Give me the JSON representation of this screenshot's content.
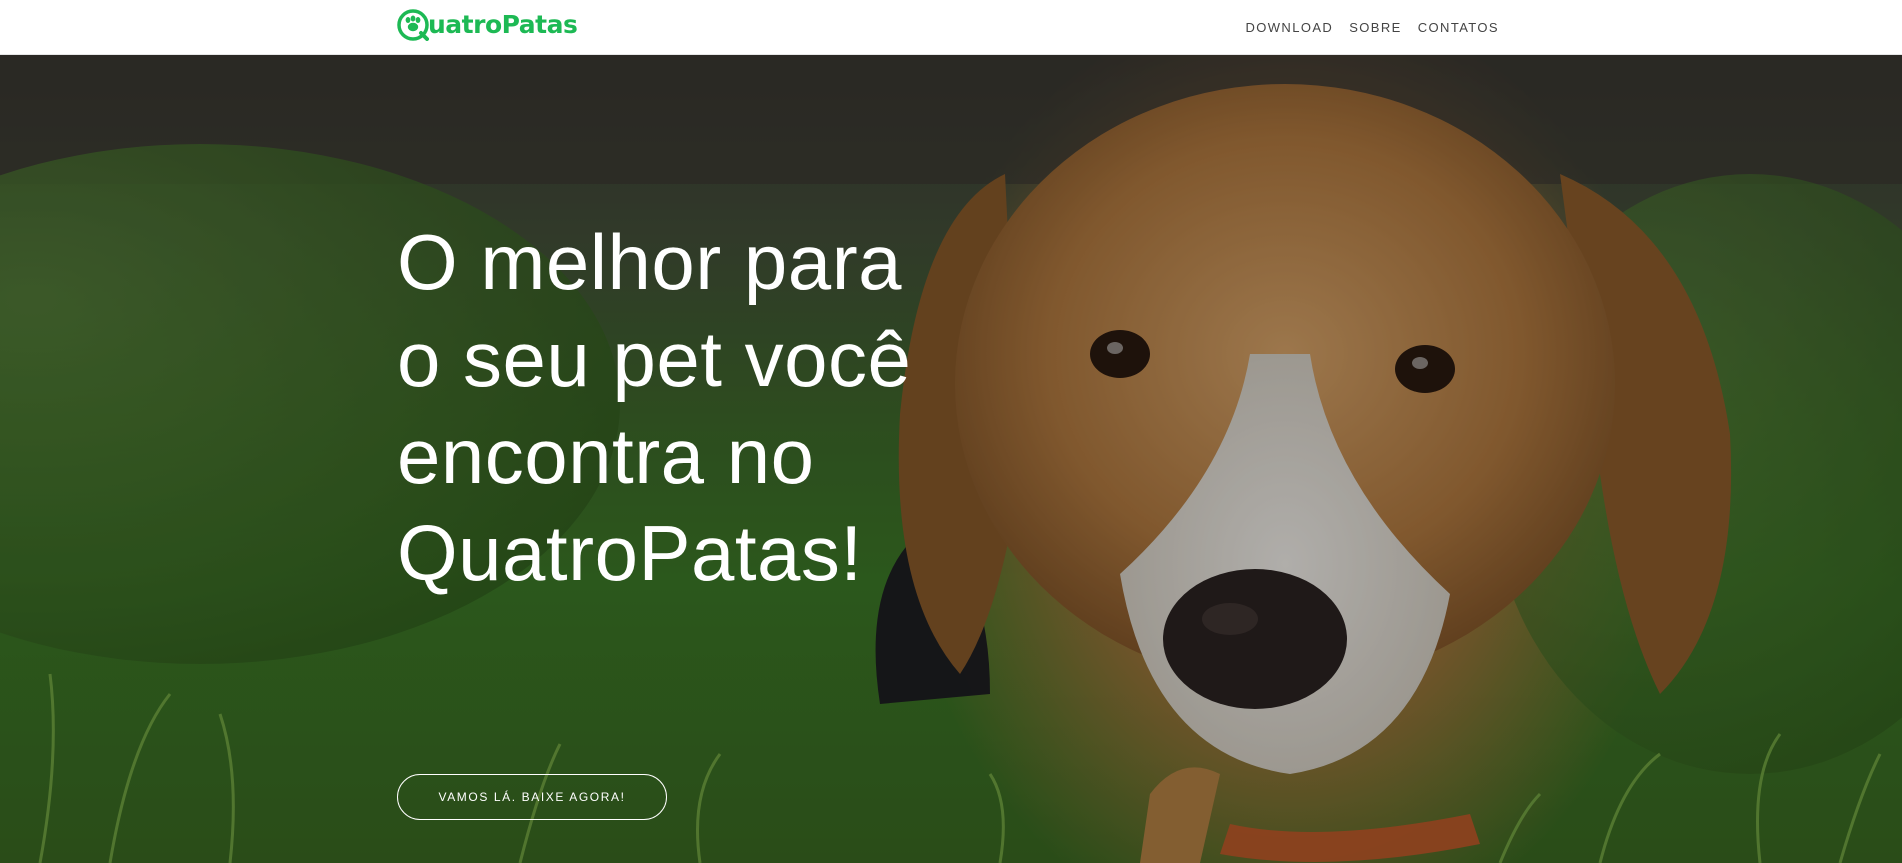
{
  "header": {
    "brand": {
      "text": "uatroPatas",
      "full_name": "QuatroPatas",
      "icon": "paw-icon",
      "color": "#1db954"
    },
    "nav": [
      {
        "label": "DOWNLOAD"
      },
      {
        "label": "SOBRE"
      },
      {
        "label": "CONTATOS"
      }
    ]
  },
  "hero": {
    "background": "puppy-in-grass-photo",
    "title": "O melhor para o seu pet você encontra no QuatroPatas!",
    "cta_label": "VAMOS LÁ. BAIXE AGORA!"
  }
}
